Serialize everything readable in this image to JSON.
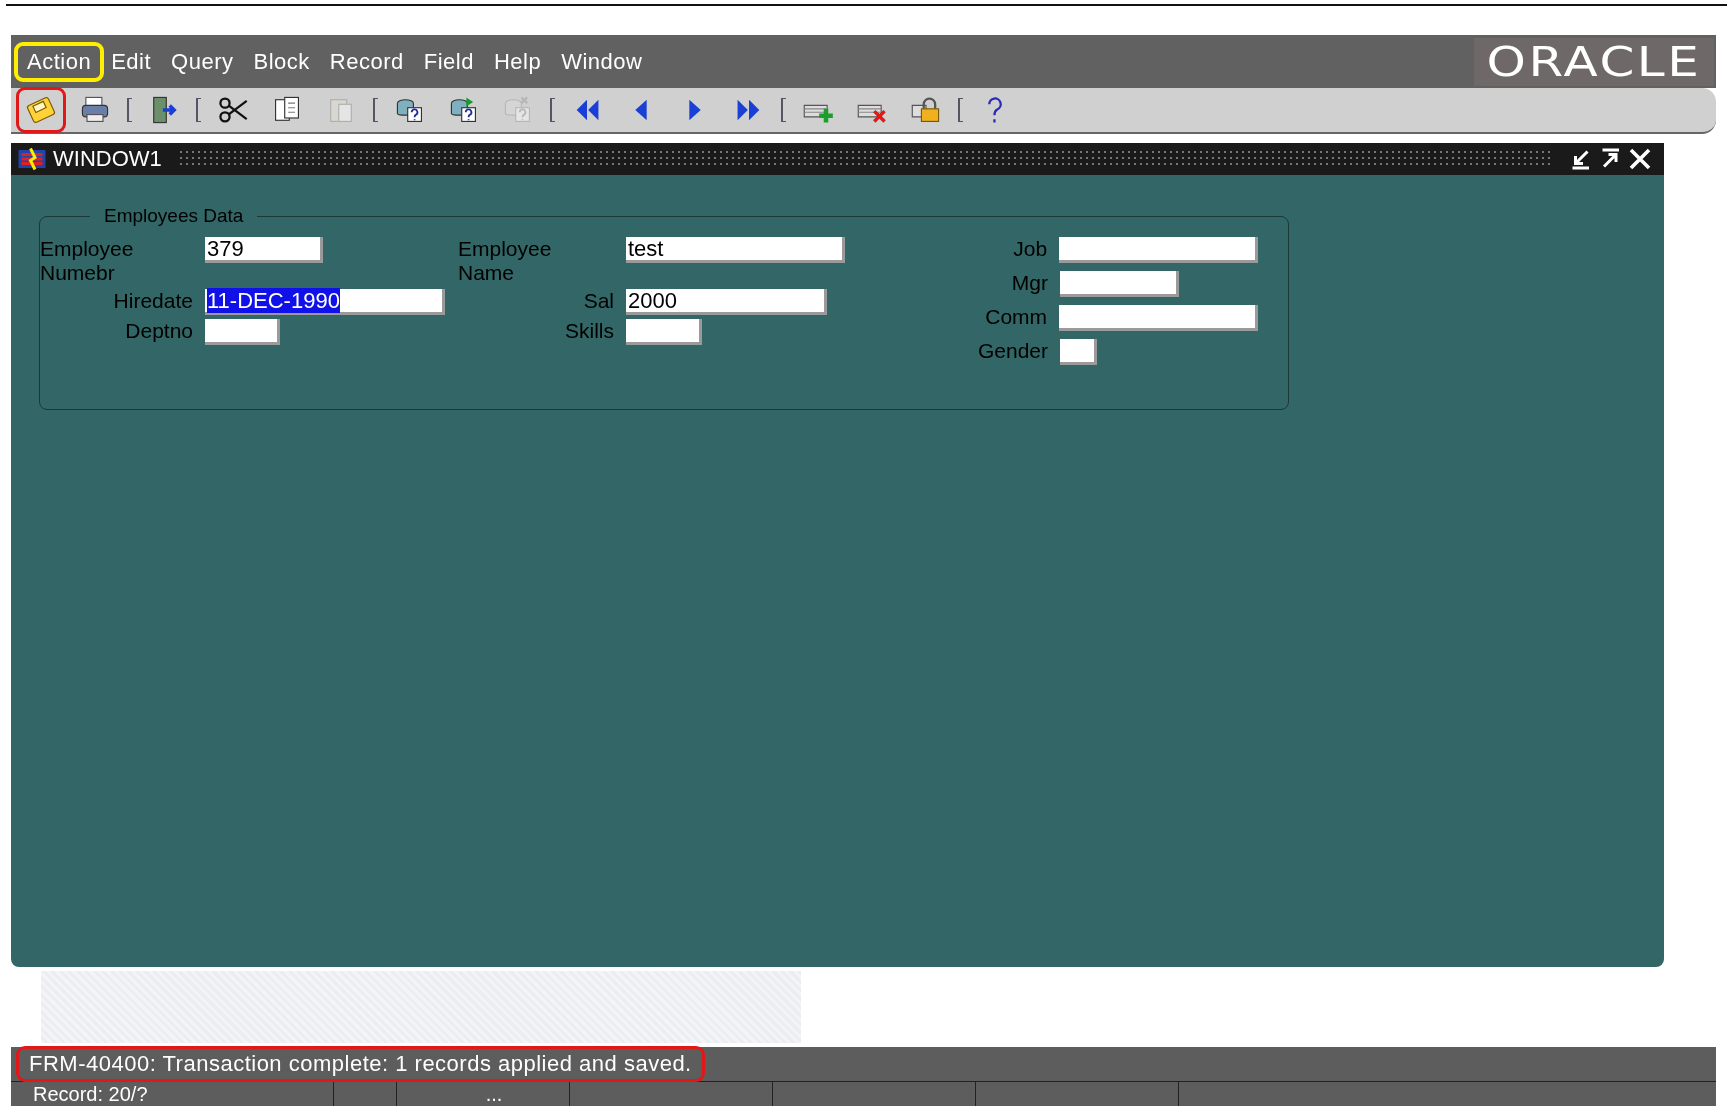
{
  "menu": [
    {
      "label": "Action",
      "highlighted": true
    },
    {
      "label": "Edit",
      "highlighted": false
    },
    {
      "label": "Query",
      "highlighted": false
    },
    {
      "label": "Block",
      "highlighted": false
    },
    {
      "label": "Record",
      "highlighted": false
    },
    {
      "label": "Field",
      "highlighted": false
    },
    {
      "label": "Help",
      "highlighted": false
    },
    {
      "label": "Window",
      "highlighted": false
    }
  ],
  "logo": {
    "text": "ORACLE"
  },
  "toolbar": [
    {
      "kind": "button",
      "disabled": false,
      "highlighted": true
    },
    {
      "kind": "button",
      "disabled": false,
      "highlighted": false
    },
    {
      "kind": "separator"
    },
    {
      "kind": "button",
      "disabled": false,
      "highlighted": false
    },
    {
      "kind": "separator"
    },
    {
      "kind": "button",
      "disabled": false,
      "highlighted": false
    },
    {
      "kind": "button",
      "disabled": false,
      "highlighted": false
    },
    {
      "kind": "button",
      "disabled": true,
      "highlighted": false
    },
    {
      "kind": "separator"
    },
    {
      "kind": "button",
      "disabled": false,
      "highlighted": false
    },
    {
      "kind": "button",
      "disabled": false,
      "highlighted": false
    },
    {
      "kind": "button",
      "disabled": true,
      "highlighted": false
    },
    {
      "kind": "separator"
    },
    {
      "kind": "button",
      "disabled": false,
      "highlighted": false
    },
    {
      "kind": "button",
      "disabled": false,
      "highlighted": false
    },
    {
      "kind": "button",
      "disabled": false,
      "highlighted": false
    },
    {
      "kind": "button",
      "disabled": false,
      "highlighted": false
    },
    {
      "kind": "separator"
    },
    {
      "kind": "button",
      "disabled": false,
      "highlighted": false
    },
    {
      "kind": "button",
      "disabled": false,
      "highlighted": false
    },
    {
      "kind": "button",
      "disabled": false,
      "highlighted": false
    },
    {
      "kind": "separator"
    },
    {
      "kind": "button",
      "disabled": false,
      "highlighted": false
    }
  ],
  "window": {
    "title": "WINDOW1",
    "frame_title": "Employees Data",
    "columns": [
      [
        {
          "label": "Employee Numebr",
          "value": "379",
          "text_selected": false
        },
        {
          "label": "Hiredate",
          "value": "11-DEC-1990",
          "text_selected": true
        },
        {
          "label": "Deptno",
          "text_selected": false
        }
      ],
      [
        {
          "label": "Employee Name",
          "value": "test",
          "text_selected": false
        },
        {
          "label": "Sal",
          "value": "2000",
          "text_selected": false
        },
        {
          "label": "Skills",
          "text_selected": false
        }
      ],
      [
        {
          "label": "Job",
          "text_selected": false
        },
        {
          "label": "Mgr",
          "text_selected": false
        },
        {
          "label": "Comm",
          "text_selected": false
        },
        {
          "label": "Gender",
          "text_selected": false
        }
      ]
    ]
  },
  "status_bar": {
    "message": "FRM-40400: Transaction complete: 1 records applied and saved.",
    "message_highlighted": true,
    "cells": [
      "Record: 20/?",
      "..."
    ]
  }
}
